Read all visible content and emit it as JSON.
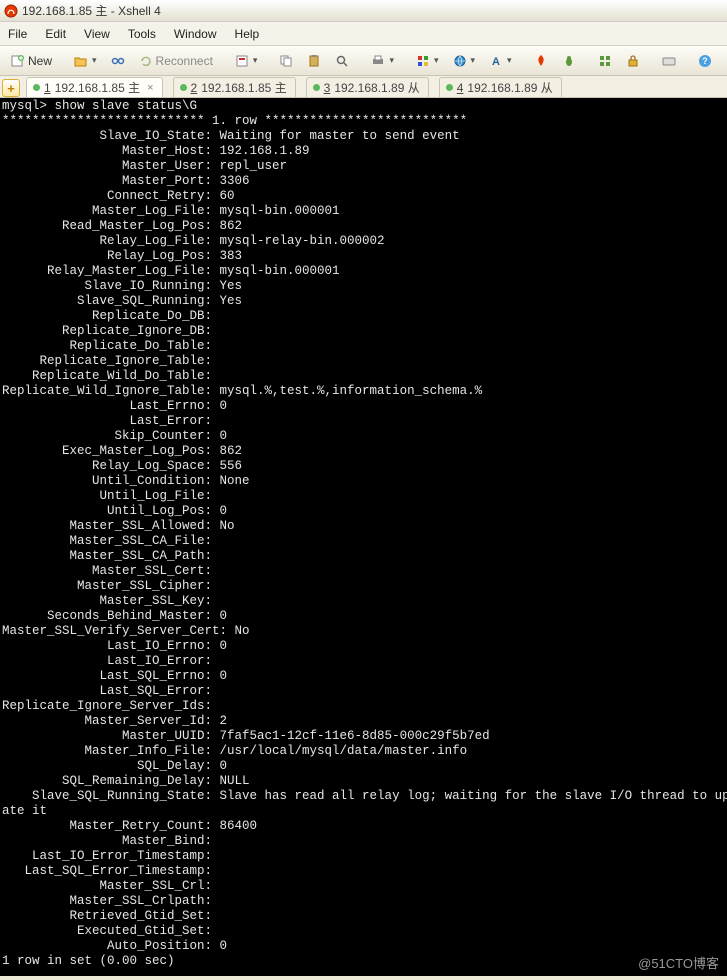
{
  "title": "192.168.1.85 主 - Xshell 4",
  "menubar": [
    "File",
    "Edit",
    "View",
    "Tools",
    "Window",
    "Help"
  ],
  "toolbar": {
    "new_label": "New",
    "reconnect_label": "Reconnect"
  },
  "tabs": [
    {
      "num": "1",
      "label": "192.168.1.85 主",
      "active": true,
      "closeable": true
    },
    {
      "num": "2",
      "label": "192.168.1.85 主",
      "active": false,
      "closeable": false
    },
    {
      "num": "3",
      "label": "192.168.1.89 从",
      "active": false,
      "closeable": false
    },
    {
      "num": "4",
      "label": "192.168.1.89 从",
      "active": false,
      "closeable": false
    }
  ],
  "terminal": {
    "prompt": "mysql> show slave status\\G",
    "row_header": "*************************** 1. row ***************************",
    "label_width": 27,
    "rows": [
      [
        "Slave_IO_State",
        "Waiting for master to send event"
      ],
      [
        "Master_Host",
        "192.168.1.89"
      ],
      [
        "Master_User",
        "repl_user"
      ],
      [
        "Master_Port",
        "3306"
      ],
      [
        "Connect_Retry",
        "60"
      ],
      [
        "Master_Log_File",
        "mysql-bin.000001"
      ],
      [
        "Read_Master_Log_Pos",
        "862"
      ],
      [
        "Relay_Log_File",
        "mysql-relay-bin.000002"
      ],
      [
        "Relay_Log_Pos",
        "383"
      ],
      [
        "Relay_Master_Log_File",
        "mysql-bin.000001"
      ],
      [
        "Slave_IO_Running",
        "Yes"
      ],
      [
        "Slave_SQL_Running",
        "Yes"
      ],
      [
        "Replicate_Do_DB",
        ""
      ],
      [
        "Replicate_Ignore_DB",
        ""
      ],
      [
        "Replicate_Do_Table",
        ""
      ],
      [
        "Replicate_Ignore_Table",
        ""
      ],
      [
        "Replicate_Wild_Do_Table",
        ""
      ],
      [
        "Replicate_Wild_Ignore_Table",
        "mysql.%,test.%,information_schema.%"
      ],
      [
        "Last_Errno",
        "0"
      ],
      [
        "Last_Error",
        ""
      ],
      [
        "Skip_Counter",
        "0"
      ],
      [
        "Exec_Master_Log_Pos",
        "862"
      ],
      [
        "Relay_Log_Space",
        "556"
      ],
      [
        "Until_Condition",
        "None"
      ],
      [
        "Until_Log_File",
        ""
      ],
      [
        "Until_Log_Pos",
        "0"
      ],
      [
        "Master_SSL_Allowed",
        "No"
      ],
      [
        "Master_SSL_CA_File",
        ""
      ],
      [
        "Master_SSL_CA_Path",
        ""
      ],
      [
        "Master_SSL_Cert",
        ""
      ],
      [
        "Master_SSL_Cipher",
        ""
      ],
      [
        "Master_SSL_Key",
        ""
      ],
      [
        "Seconds_Behind_Master",
        "0"
      ],
      [
        "Master_SSL_Verify_Server_Cert",
        "No"
      ],
      [
        "Last_IO_Errno",
        "0"
      ],
      [
        "Last_IO_Error",
        ""
      ],
      [
        "Last_SQL_Errno",
        "0"
      ],
      [
        "Last_SQL_Error",
        ""
      ],
      [
        "Replicate_Ignore_Server_Ids",
        ""
      ],
      [
        "Master_Server_Id",
        "2"
      ],
      [
        "Master_UUID",
        "7faf5ac1-12cf-11e6-8d85-000c29f5b7ed"
      ],
      [
        "Master_Info_File",
        "/usr/local/mysql/data/master.info"
      ],
      [
        "SQL_Delay",
        "0"
      ],
      [
        "SQL_Remaining_Delay",
        "NULL"
      ],
      [
        "Slave_SQL_Running_State",
        "Slave has read all relay log; waiting for the slave I/O thread to update it"
      ],
      [
        "Master_Retry_Count",
        "86400"
      ],
      [
        "Master_Bind",
        ""
      ],
      [
        "Last_IO_Error_Timestamp",
        ""
      ],
      [
        "Last_SQL_Error_Timestamp",
        ""
      ],
      [
        "Master_SSL_Crl",
        ""
      ],
      [
        "Master_SSL_Crlpath",
        ""
      ],
      [
        "Retrieved_Gtid_Set",
        ""
      ],
      [
        "Executed_Gtid_Set",
        ""
      ],
      [
        "Auto_Position",
        "0"
      ]
    ],
    "footer": "1 row in set (0.00 sec)"
  },
  "watermark": "@51CTO博客"
}
